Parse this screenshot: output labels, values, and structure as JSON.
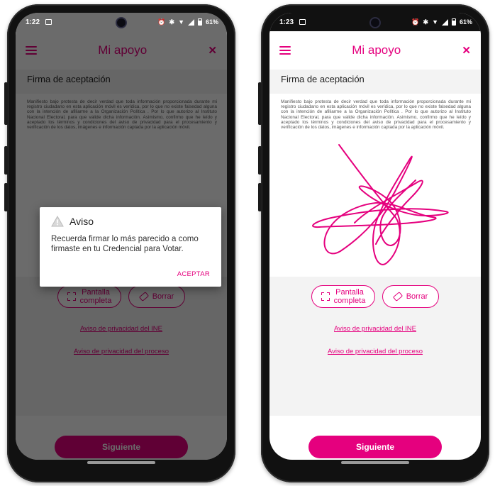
{
  "brand_color": "#e5007e",
  "app": {
    "title": "Mi apoyo",
    "section_title": "Firma de aceptación",
    "terms_text": "Manifiesto bajo protesta de decir verdad que toda información proporcionada durante mi registro ciudadano en esta aplicación móvil es verídica, por lo que no existe falsedad alguna con la intención de afiliarme a la Organización Política                                    . Por lo que autorizo al Instituto Nacional Electoral, para que valide dicha información. Asimismo, confirmo que he leído y aceptado los términos y condiciones del aviso de privacidad para el procesamiento y verificación de los datos, imágenes e información captada por la aplicación móvil.",
    "fullscreen_label_1": "Pantalla",
    "fullscreen_label_2": "completa",
    "erase_label": "Borrar",
    "privacy_ine_link": "Aviso de privacidad del INE",
    "privacy_process_link": "Aviso de privacidad del proceso",
    "next_label": "Siguiente"
  },
  "left_phone": {
    "time": "1:22",
    "battery": "61%",
    "dialog": {
      "title": "Aviso",
      "message": "Recuerda firmar lo más parecido a como firmaste en tu Credencial para Votar.",
      "ok_label": "ACEPTAR"
    }
  },
  "right_phone": {
    "time": "1:23",
    "battery": "61%"
  },
  "icons": {
    "menu": "hamburger-menu-icon",
    "close": "close-icon",
    "fullscreen": "fullscreen-icon",
    "erase": "eraser-icon",
    "warning": "warning-icon"
  }
}
